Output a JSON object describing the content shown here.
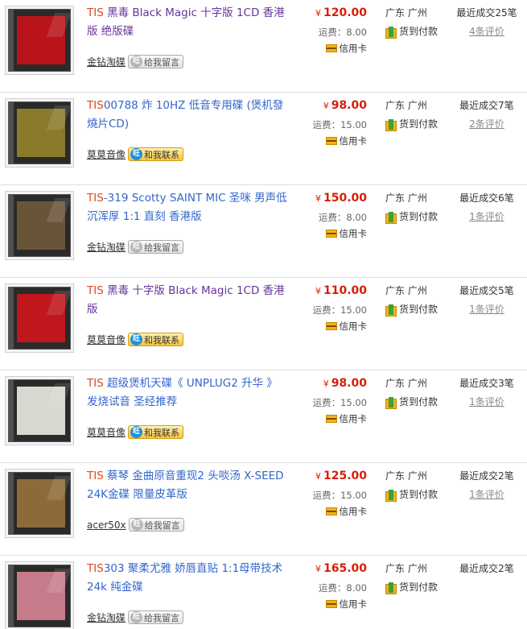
{
  "items": [
    {
      "brand": "TIS",
      "rest": " 黑毒 Black Magic 十字版 1CD 香港版 绝版碟",
      "visited": true,
      "price": "120.00",
      "currency": "¥",
      "shipping": "运费：8.00",
      "card": "信用卡",
      "location": "广东 广州",
      "cod": "货到付款",
      "deals": "最近成交25笔",
      "reviews": "4条评价",
      "seller": "金钻淘碟",
      "contact": "给我留言",
      "online": false,
      "cover_color": "#b8141a"
    },
    {
      "brand": "TIS",
      "rest": "00788 炸 10HZ 低音专用碟 (煲机發燒片CD)",
      "visited": false,
      "price": "98.00",
      "currency": "¥",
      "shipping": "运费：15.00",
      "card": "信用卡",
      "location": "广东 广州",
      "cod": "货到付款",
      "deals": "最近成交7笔",
      "reviews": "2条评价",
      "seller": "莫莫音像",
      "contact": "和我联系",
      "online": true,
      "cover_color": "#8a7a2a"
    },
    {
      "brand": "TIS",
      "rest": "-319 Scotty SAINT MIC 圣咪 男声低沉浑厚 1:1 直刻 香港版",
      "visited": false,
      "price": "150.00",
      "currency": "¥",
      "shipping": "运费：8.00",
      "card": "信用卡",
      "location": "广东 广州",
      "cod": "货到付款",
      "deals": "最近成交6笔",
      "reviews": "1条评价",
      "seller": "金钻淘碟",
      "contact": "给我留言",
      "online": false,
      "cover_color": "#6a5438"
    },
    {
      "brand": "TIS",
      "rest": " 黑毒 十字版 Black Magic 1CD 香港版",
      "visited": true,
      "price": "110.00",
      "currency": "¥",
      "shipping": "运费：15.00",
      "card": "信用卡",
      "location": "广东 广州",
      "cod": "货到付款",
      "deals": "最近成交5笔",
      "reviews": "1条评价",
      "seller": "莫莫音像",
      "contact": "和我联系",
      "online": true,
      "cover_color": "#c0161c"
    },
    {
      "brand": "TIS",
      "rest": " 超级煲机天碟《 UNPLUG2 升华 》发烧试音 圣经推荐",
      "visited": false,
      "price": "98.00",
      "currency": "¥",
      "shipping": "运费：15.00",
      "card": "信用卡",
      "location": "广东 广州",
      "cod": "货到付款",
      "deals": "最近成交3笔",
      "reviews": "1条评价",
      "seller": "莫莫音像",
      "contact": "和我联系",
      "online": true,
      "cover_color": "#d8d8d0"
    },
    {
      "brand": "TIS",
      "rest": " 蔡琴 金曲原音重现2 头啖汤 X-SEED 24K金碟 限量皮革版",
      "visited": false,
      "price": "125.00",
      "currency": "¥",
      "shipping": "运费：15.00",
      "card": "信用卡",
      "location": "广东 广州",
      "cod": "货到付款",
      "deals": "最近成交2笔",
      "reviews": "1条评价",
      "seller": "acer50x",
      "contact": "给我留言",
      "online": false,
      "cover_color": "#8c6a3a"
    },
    {
      "brand": "TIS",
      "rest": "303 聚柔尤雅 娇唇直贴 1:1母带技术 24k 纯金碟",
      "visited": false,
      "price": "165.00",
      "currency": "¥",
      "shipping": "运费：8.00",
      "card": "信用卡",
      "location": "广东 广州",
      "cod": "货到付款",
      "deals": "最近成交2笔",
      "reviews": "",
      "seller": "金钻淘碟",
      "contact": "给我留言",
      "online": false,
      "cover_color": "#c77a8a"
    }
  ]
}
